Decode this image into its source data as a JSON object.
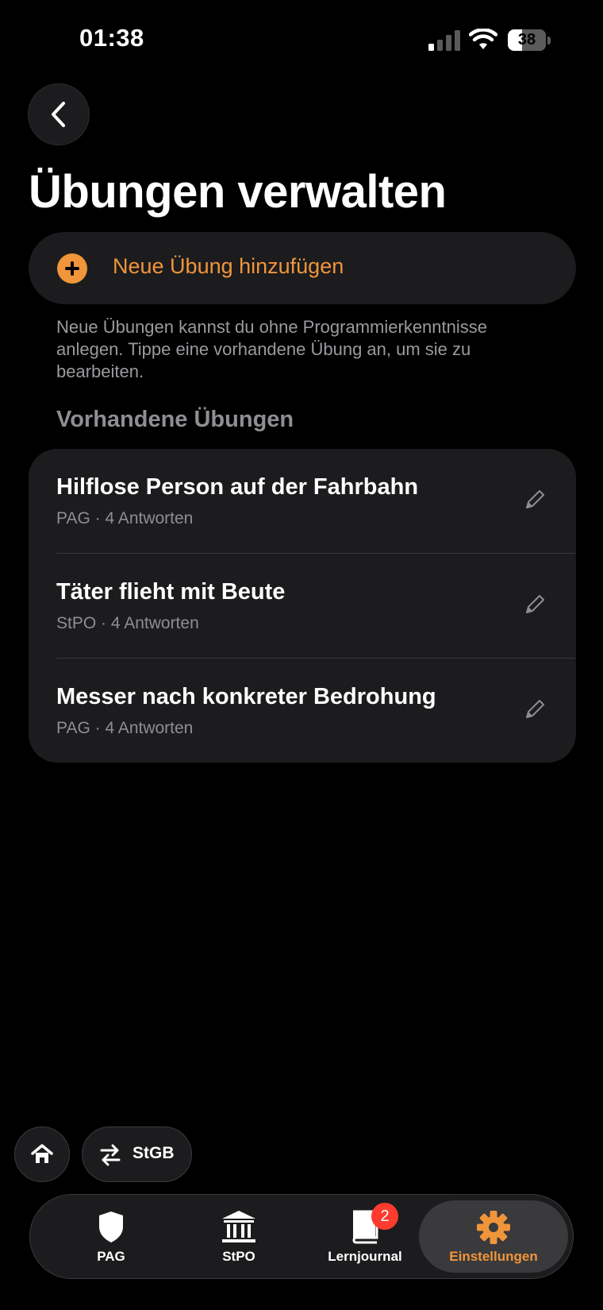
{
  "status_bar": {
    "time": "01:38",
    "battery": "38"
  },
  "header": {
    "title": "Übungen verwalten"
  },
  "add_exercise": {
    "label": "Neue Übung hinzufügen",
    "hint": "Neue Übungen kannst du ohne Programmierkenntnisse anlegen. Tippe eine vorhandene Übung an, um sie zu bearbeiten."
  },
  "existing": {
    "section_title": "Vorhandene Übungen",
    "items": [
      {
        "title": "Hilflose Person auf der Fahrbahn",
        "subtitle": "PAG · 4 Antworten"
      },
      {
        "title": "Täter flieht mit Beute",
        "subtitle": "StPO · 4 Antworten"
      },
      {
        "title": "Messer nach konkreter Bedrohung",
        "subtitle": "PAG · 4 Antworten"
      }
    ]
  },
  "quick_actions": {
    "switch_label": "StGB"
  },
  "tab_bar": {
    "tabs": [
      {
        "label": "PAG",
        "icon": "shield-icon"
      },
      {
        "label": "StPO",
        "icon": "courthouse-icon"
      },
      {
        "label": "Lernjournal",
        "icon": "book-icon",
        "badge": "2"
      },
      {
        "label": "Einstellungen",
        "icon": "gear-icon",
        "active": true
      }
    ]
  },
  "colors": {
    "accent": "#f0953a",
    "background": "#000000",
    "card": "#1c1c1e",
    "badge": "#ff3b30"
  }
}
